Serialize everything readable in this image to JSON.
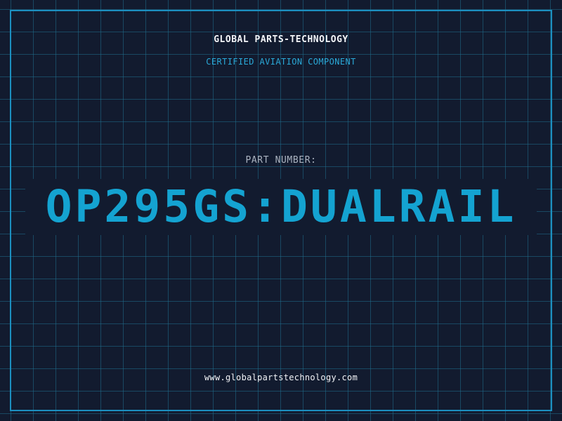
{
  "header": {
    "brand": "GLOBAL PARTS-TECHNOLOGY",
    "tagline": "CERTIFIED AVIATION COMPONENT"
  },
  "part": {
    "label": "PART NUMBER:",
    "number": "OP295GS:DUALRAIL"
  },
  "footer": {
    "website": "www.globalpartstechnology.com"
  },
  "colors": {
    "background": "#121b2f",
    "grid": "#1f6e8c",
    "frame": "#1c8fc0",
    "accent": "#14a3d1",
    "text": "#f2f4f7",
    "muted": "#aab3c0"
  }
}
